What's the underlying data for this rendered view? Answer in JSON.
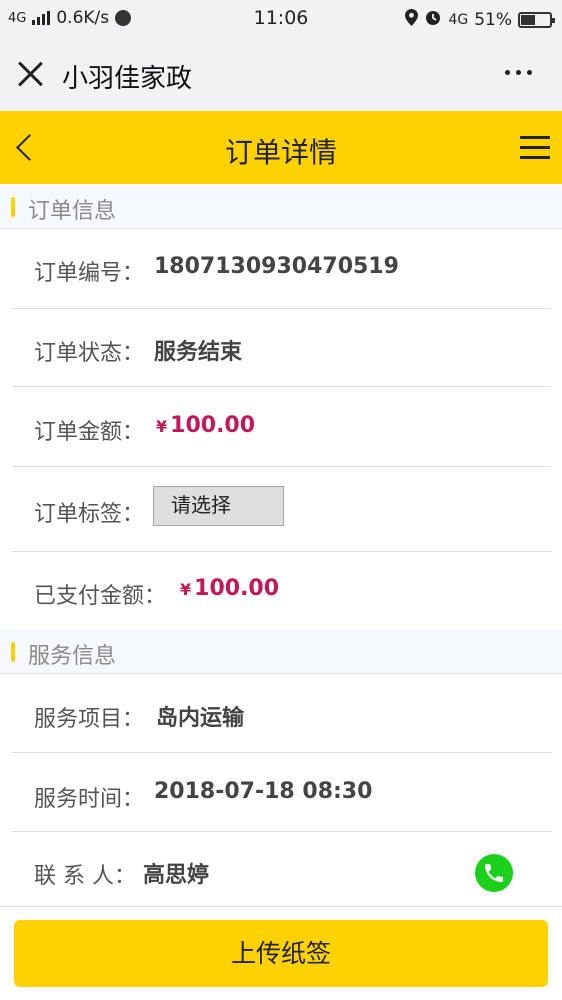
{
  "status_bar": {
    "network": "4G",
    "speed": "0.6K/s",
    "time": "11:06",
    "network_right": "4G",
    "battery": "51%"
  },
  "wechat": {
    "title": "小羽佳家政",
    "close_icon": "close-icon",
    "more_icon": "more-icon"
  },
  "header": {
    "title": "订单详情",
    "back_icon": "back-arrow-icon",
    "menu_icon": "menu-icon",
    "accent": "#fed200"
  },
  "order_info": {
    "section_title": "订单信息",
    "order_no_label": "订单编号：",
    "order_no": "1807130930470519",
    "status_label": "订单状态：",
    "status": "服务结束",
    "amount_label": "订单金额：",
    "currency": "¥",
    "amount": "100.00",
    "tag_label": "订单标签：",
    "tag_select": "请选择",
    "paid_label": "已支付金额：",
    "paid": "100.00"
  },
  "service_info": {
    "section_title": "服务信息",
    "item_label": "服务项目：",
    "item": "岛内运输",
    "time_label": "服务时间：",
    "time": "2018-07-18 08:30",
    "contact_label": "联 系 人：",
    "contact": "高思婷",
    "phone_icon": "phone-icon"
  },
  "footer": {
    "upload_label": "上传纸签"
  },
  "colors": {
    "price": "#c2185b",
    "phone": "#1ad01a"
  }
}
